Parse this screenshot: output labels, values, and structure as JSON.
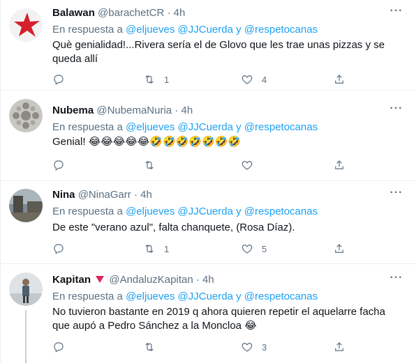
{
  "tweets": [
    {
      "name": "Balawan",
      "handle": "@barachetCR",
      "dot": "·",
      "time": "4h",
      "reply_prefix": "En respuesta a",
      "mention1": "@eljueves",
      "mention2": "@JJCuerda",
      "conj": "y",
      "mention3": "@respetocanas",
      "text": "Què genialidad!...Rivera sería el de Glovo que les trae unas pizzas y se queda allí",
      "retweets": "1",
      "likes": "4"
    },
    {
      "name": "Nubema",
      "handle": "@NubemaNuria",
      "dot": "·",
      "time": "4h",
      "reply_prefix": "En respuesta a",
      "mention1": "@eljueves",
      "mention2": "@JJCuerda",
      "conj": "y",
      "mention3": "@respetocanas",
      "text": "Genial! 😂😂😂😂😂🤣🤣🤣🤣🤣🤣🤣",
      "retweets": "",
      "likes": ""
    },
    {
      "name": "Nina",
      "handle": "@NinaGarr",
      "dot": "·",
      "time": "4h",
      "reply_prefix": "En respuesta a",
      "mention1": "@eljueves",
      "mention2": "@JJCuerda",
      "conj": "y",
      "mention3": "@respetocanas",
      "text": "De este \"verano azul\", falta chanquete, (Rosa Díaz).",
      "retweets": "1",
      "likes": "5"
    },
    {
      "name": "Kapitan",
      "handle": "@AndaluzKapitan",
      "dot": "·",
      "time": "4h",
      "reply_prefix": "En respuesta a",
      "mention1": "@eljueves",
      "mention2": "@JJCuerda",
      "conj": "y",
      "mention3": "@respetocanas",
      "text": "No tuvieron bastante en 2019 q ahora quieren repetir el aquelarre facha que aupó a Pedro Sánchez a la Moncloa 😂",
      "retweets": "",
      "likes": "3"
    }
  ],
  "colors": {
    "accent": "#1da1f2",
    "muted": "#5b7083",
    "text": "#0f1419",
    "divider": "#ebeef0",
    "kapitan_badge": "#e0245e"
  },
  "icons": [
    "reply-icon",
    "retweet-icon",
    "like-icon",
    "share-icon",
    "more-icon"
  ]
}
